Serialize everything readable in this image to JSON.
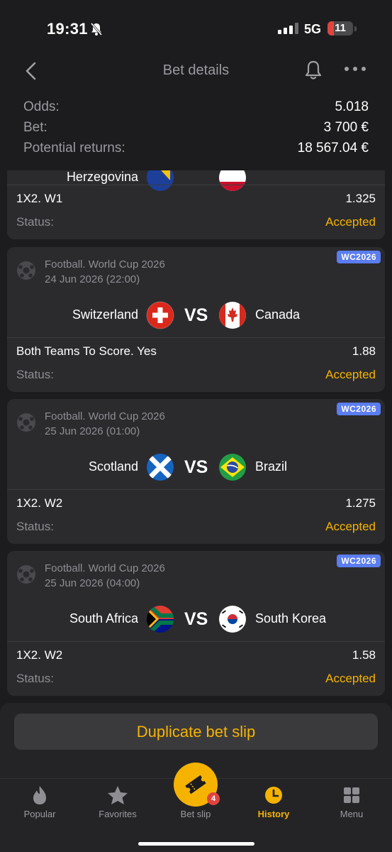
{
  "status_bar": {
    "time": "19:31",
    "network": "5G",
    "battery": "11"
  },
  "header": {
    "title": "Bet details"
  },
  "summary": {
    "odds_label": "Odds:",
    "odds_value": "5.018",
    "bet_label": "Bet:",
    "bet_value": "3 700 €",
    "returns_label": "Potential returns:",
    "returns_value": "18 567.04 €"
  },
  "partial_card": {
    "team1": "Herzegovina",
    "market": "1X2. W1",
    "odds": "1.325",
    "status_label": "Status:",
    "status_value": "Accepted"
  },
  "cards": [
    {
      "competition": "Football. World Cup 2026",
      "datetime": "24 Jun 2026 (22:00)",
      "badge": "WC2026",
      "team1": "Switzerland",
      "flag1": "switzerland-flag-icon",
      "vs": "VS",
      "team2": "Canada",
      "flag2": "canada-flag-icon",
      "market": "Both Teams To Score. Yes",
      "odds": "1.88",
      "status_label": "Status:",
      "status_value": "Accepted"
    },
    {
      "competition": "Football. World Cup 2026",
      "datetime": "25 Jun 2026 (01:00)",
      "badge": "WC2026",
      "team1": "Scotland",
      "flag1": "scotland-flag-icon",
      "vs": "VS",
      "team2": "Brazil",
      "flag2": "brazil-flag-icon",
      "market": "1X2. W2",
      "odds": "1.275",
      "status_label": "Status:",
      "status_value": "Accepted"
    },
    {
      "competition": "Football. World Cup 2026",
      "datetime": "25 Jun 2026 (04:00)",
      "badge": "WC2026",
      "team1": "South Africa",
      "flag1": "south-africa-flag-icon",
      "vs": "VS",
      "team2": "South Korea",
      "flag2": "south-korea-flag-icon",
      "market": "1X2. W2",
      "odds": "1.58",
      "status_label": "Status:",
      "status_value": "Accepted"
    }
  ],
  "duplicate_button": "Duplicate bet slip",
  "tabs": [
    {
      "label": "Popular",
      "icon": "flame-icon"
    },
    {
      "label": "Favorites",
      "icon": "star-icon"
    },
    {
      "label": "Bet slip",
      "icon": "ticket-icon",
      "badge": "4"
    },
    {
      "label": "History",
      "icon": "clock-icon",
      "active": true
    },
    {
      "label": "Menu",
      "icon": "grid-icon"
    }
  ],
  "colors": {
    "accent": "#f5b300",
    "badge": "#5b7df0",
    "card": "#2b2b2e",
    "background": "#1c1c1e"
  }
}
